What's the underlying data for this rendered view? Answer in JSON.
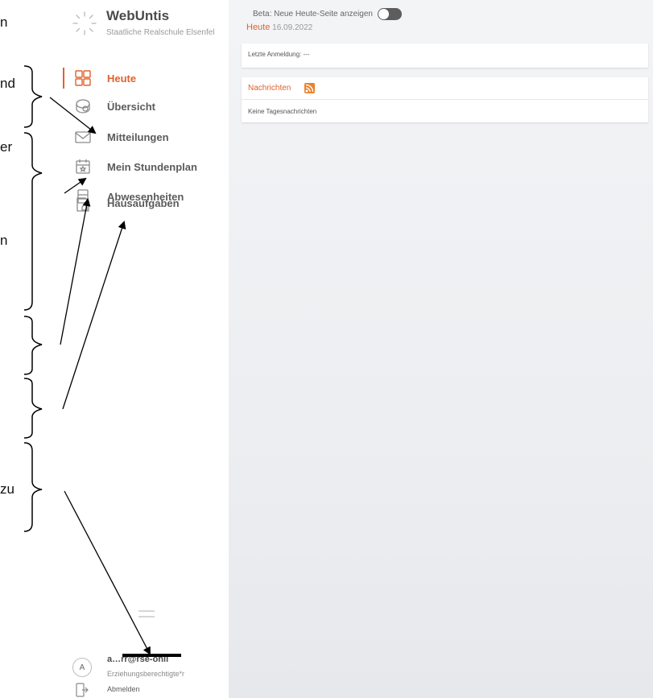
{
  "annotations": {
    "fragments": [
      "n",
      "nd",
      "er",
      "n",
      "zu"
    ]
  },
  "sidebar": {
    "app_name": "WebUntis",
    "school": "Staatliche Realschule Elsenfel",
    "items": [
      {
        "label": "Heute",
        "active": true
      },
      {
        "label": "Übersicht",
        "active": false
      },
      {
        "label": "Mitteilungen",
        "active": false
      },
      {
        "label": "Mein Stundenplan",
        "active": false
      },
      {
        "label": "Abwesenheiten",
        "active": false
      },
      {
        "label": "Hausaufgaben",
        "active": false
      }
    ],
    "user": {
      "avatar_letter": "A",
      "email": "a…rr@rse-onli",
      "role": "Erziehungsberechtigte*r",
      "logout": "Abmelden"
    }
  },
  "main": {
    "beta_label": "Beta: Neue Heute-Seite anzeigen",
    "beta_toggle_on": false,
    "title": "Heute",
    "date": "16.09.2022",
    "last_login": "Letzte Anmeldung: ---",
    "news_title": "Nachrichten",
    "news_empty": "Keine Tagesnachrichten"
  },
  "colors": {
    "accent": "#e0622f",
    "rss": "#e8832f",
    "toggle_off": "#5d5d5d"
  }
}
